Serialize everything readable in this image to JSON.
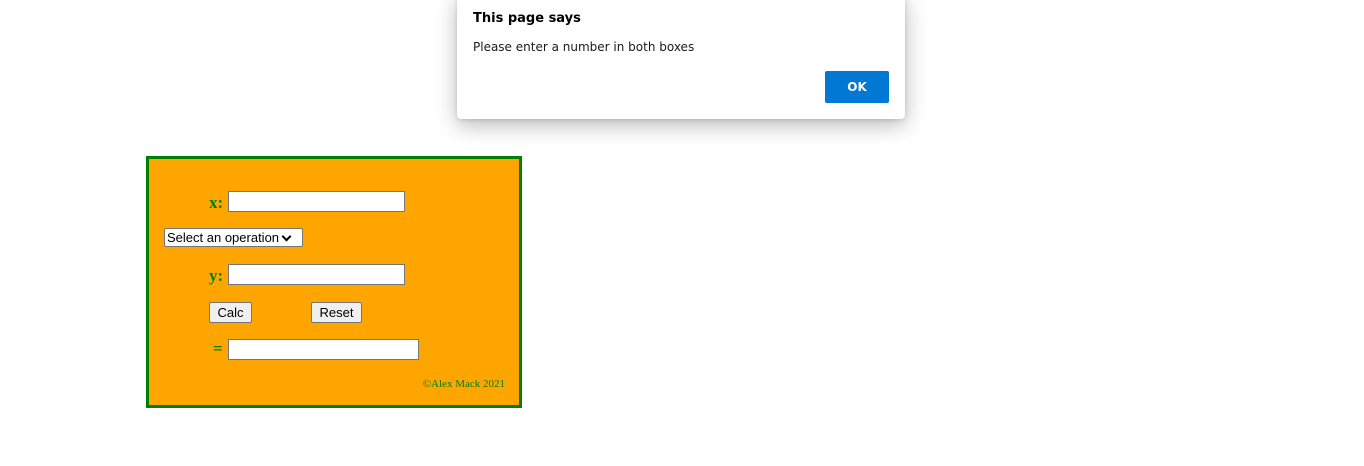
{
  "calculator": {
    "x_label": "x:",
    "y_label": "y:",
    "equals_label": "=",
    "x_value": "",
    "y_value": "",
    "result_value": "",
    "operation_selected": "Select an operation",
    "calc_button": "Calc",
    "reset_button": "Reset",
    "copyright": "©Alex Mack 2021",
    "colors": {
      "panel_background": "#ffa500",
      "panel_border": "#008000",
      "label_text": "#008000"
    }
  },
  "alert": {
    "title": "This page says",
    "message": "Please enter a number in both boxes",
    "ok_button": "OK",
    "colors": {
      "ok_button": "#0078d4"
    }
  }
}
